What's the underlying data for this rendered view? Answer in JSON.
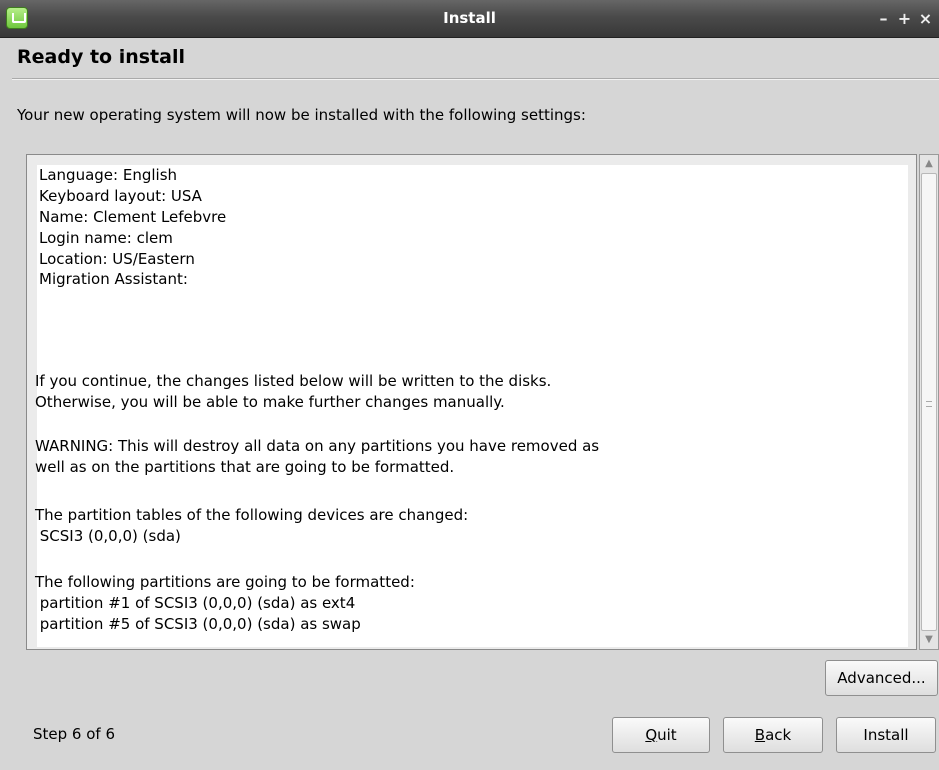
{
  "window": {
    "title": "Install",
    "controls": {
      "minimize": "–",
      "maximize": "+",
      "close": "×"
    }
  },
  "page": {
    "heading": "Ready to install",
    "intro": "Your new operating system will now be installed with the following settings:"
  },
  "summary": {
    "settings": [
      "Language: English",
      "Keyboard layout: USA",
      "Name: Clement Lefebvre",
      "Login name: clem",
      "Location: US/Eastern",
      "Migration Assistant:"
    ],
    "notice": [
      "If you continue, the changes listed below will be written to the disks.",
      "Otherwise, you will be able to make further changes manually."
    ],
    "warning": [
      "WARNING: This will destroy all data on any partitions you have removed as",
      "well as on the partitions that are going to be formatted."
    ],
    "partition_tables": {
      "header": "The partition tables of the following devices are changed:",
      "devices": [
        " SCSI3 (0,0,0) (sda)"
      ]
    },
    "formatting": {
      "header": "The following partitions are going to be formatted:",
      "partitions": [
        " partition #1 of SCSI3 (0,0,0) (sda) as ext4",
        " partition #5 of SCSI3 (0,0,0) (sda) as swap"
      ]
    }
  },
  "buttons": {
    "advanced": "Advanced...",
    "quit_accel": "Q",
    "quit_rest": "uit",
    "back_accel": "B",
    "back_rest": "ack",
    "install": "Install"
  },
  "status": {
    "step": "Step 6 of 6"
  }
}
